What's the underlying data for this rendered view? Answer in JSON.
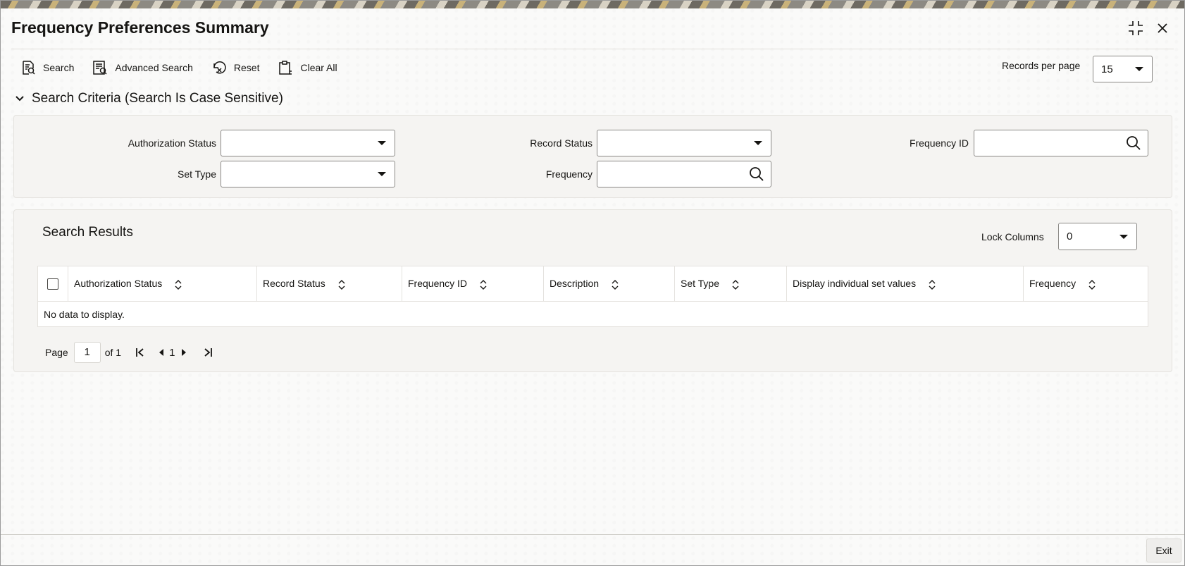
{
  "window": {
    "title": "Frequency Preferences Summary",
    "icons": [
      "collapse-icon",
      "close-icon"
    ]
  },
  "toolbar": {
    "search_label": "Search",
    "advanced_search_label": "Advanced Search",
    "reset_label": "Reset",
    "clear_all_label": "Clear All",
    "records_per_page_label": "Records per page",
    "records_per_page_value": "15"
  },
  "criteria": {
    "heading": "Search Criteria (Search Is Case Sensitive)",
    "authorization_status_label": "Authorization Status",
    "authorization_status_value": "",
    "record_status_label": "Record Status",
    "record_status_value": "",
    "frequency_id_label": "Frequency ID",
    "frequency_id_value": "",
    "set_type_label": "Set Type",
    "set_type_value": "",
    "frequency_label": "Frequency",
    "frequency_value": ""
  },
  "results": {
    "heading": "Search Results",
    "lock_columns_label": "Lock Columns",
    "lock_columns_value": "0",
    "columns": [
      "Authorization Status",
      "Record Status",
      "Frequency ID",
      "Description",
      "Set Type",
      "Display individual set values",
      "Frequency"
    ],
    "empty_message": "No data to display."
  },
  "pager": {
    "page_label": "Page",
    "page_value": "1",
    "of_label": "of 1",
    "current_page": "1"
  },
  "footer": {
    "exit_label": "Exit"
  },
  "colors": {
    "text": "#161513",
    "panel": "#f5f4f2",
    "border": "#8a8885"
  }
}
